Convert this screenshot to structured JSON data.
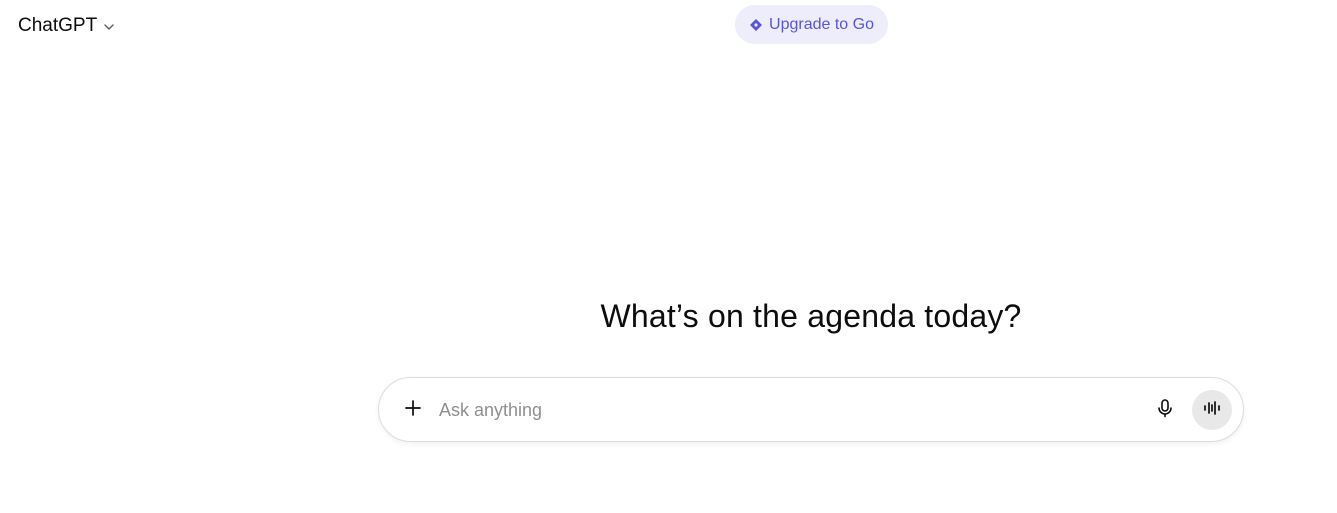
{
  "header": {
    "model_name": "ChatGPT",
    "model_icon": "chevron-down-icon",
    "upgrade_label": "Upgrade to Go",
    "upgrade_icon": "diamond-icon",
    "upgrade_color": "#5856d6",
    "upgrade_bg": "#ededfb"
  },
  "main": {
    "headline": "What’s on the agenda today?"
  },
  "composer": {
    "placeholder": "Ask anything",
    "value": "",
    "plus_icon": "plus-icon",
    "mic_icon": "microphone-icon",
    "voice_icon": "voice-mode-icon"
  }
}
